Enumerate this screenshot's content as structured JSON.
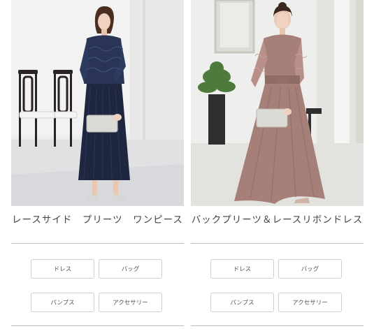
{
  "products": [
    {
      "title": "レースサイド　プリーツ　ワンピース",
      "tags": [
        "ドレス",
        "バッグ",
        "パンプス",
        "アクセサリー"
      ]
    },
    {
      "title": "バックプリーツ＆レースリボンドレス",
      "tags": [
        "ドレス",
        "バッグ",
        "パンプス",
        "アクセサリー"
      ]
    }
  ],
  "colors": {
    "navy_dress": "#1f2640",
    "mauve_dress": "#a57f78",
    "divider": "#bdbdbd"
  }
}
